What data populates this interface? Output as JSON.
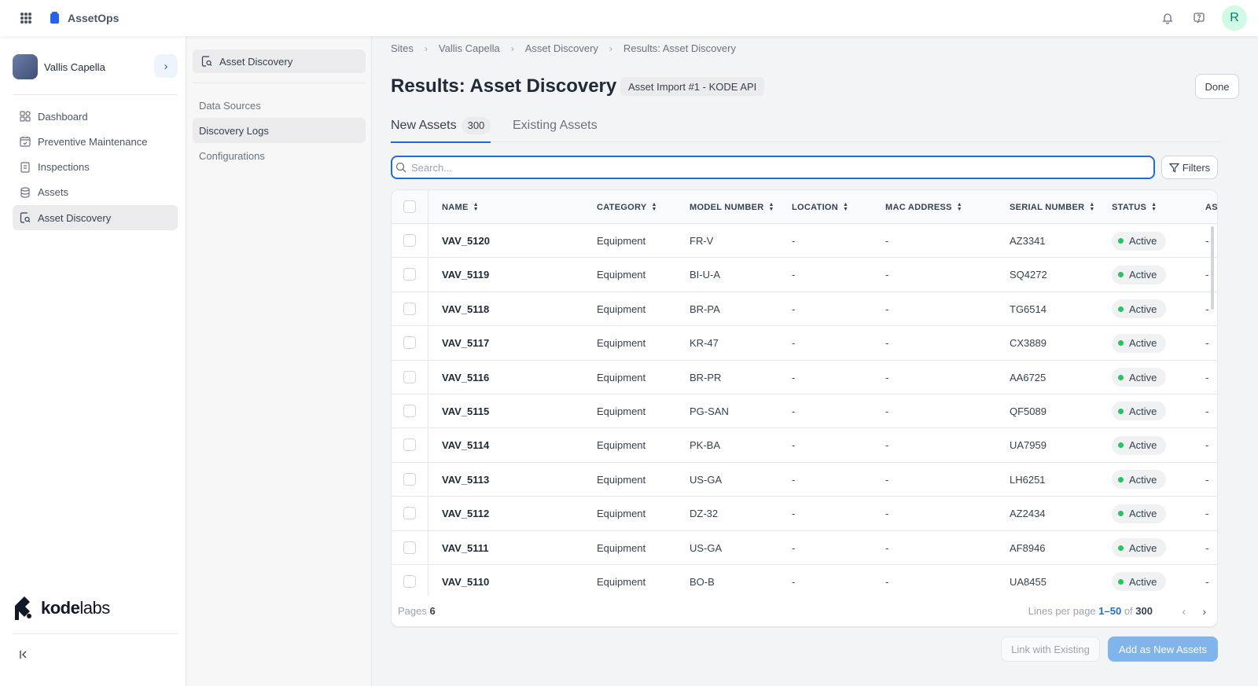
{
  "app": {
    "name": "AssetOps",
    "user_initial": "R"
  },
  "sidebar": {
    "site_name": "Vallis Capella",
    "items": [
      {
        "label": "Dashboard",
        "icon": "dashboard-icon"
      },
      {
        "label": "Preventive Maintenance",
        "icon": "calendar-icon"
      },
      {
        "label": "Inspections",
        "icon": "clipboard-icon"
      },
      {
        "label": "Assets",
        "icon": "layers-icon"
      },
      {
        "label": "Asset Discovery",
        "icon": "asset-discovery-icon",
        "active": true
      }
    ],
    "logo_text_bold": "kode",
    "logo_text_light": "labs"
  },
  "subnav": {
    "header": "Asset Discovery",
    "items": [
      {
        "label": "Data Sources"
      },
      {
        "label": "Discovery Logs",
        "active": true
      },
      {
        "label": "Configurations"
      }
    ]
  },
  "breadcrumb": [
    "Sites",
    "Vallis Capella",
    "Asset Discovery",
    "Results: Asset Discovery"
  ],
  "page": {
    "title": "Results: Asset Discovery",
    "import_badge": "Asset Import #1 - KODE API",
    "done_label": "Done"
  },
  "tabs": [
    {
      "label": "New Assets",
      "count": "300",
      "active": true
    },
    {
      "label": "Existing Assets"
    }
  ],
  "search": {
    "placeholder": "Search...",
    "filters_label": "Filters"
  },
  "table": {
    "columns": [
      "NAME",
      "CATEGORY",
      "MODEL NUMBER",
      "LOCATION",
      "MAC ADDRESS",
      "SERIAL NUMBER",
      "STATUS",
      "AS"
    ],
    "rows": [
      {
        "name": "VAV_5120",
        "category": "Equipment",
        "model": "FR-V",
        "location": "-",
        "mac": "-",
        "serial": "AZ3341",
        "status": "Active",
        "extra": "-"
      },
      {
        "name": "VAV_5119",
        "category": "Equipment",
        "model": "BI-U-A",
        "location": "-",
        "mac": "-",
        "serial": "SQ4272",
        "status": "Active",
        "extra": "-"
      },
      {
        "name": "VAV_5118",
        "category": "Equipment",
        "model": "BR-PA",
        "location": "-",
        "mac": "-",
        "serial": "TG6514",
        "status": "Active",
        "extra": "-"
      },
      {
        "name": "VAV_5117",
        "category": "Equipment",
        "model": "KR-47",
        "location": "-",
        "mac": "-",
        "serial": "CX3889",
        "status": "Active",
        "extra": "-"
      },
      {
        "name": "VAV_5116",
        "category": "Equipment",
        "model": "BR-PR",
        "location": "-",
        "mac": "-",
        "serial": "AA6725",
        "status": "Active",
        "extra": "-"
      },
      {
        "name": "VAV_5115",
        "category": "Equipment",
        "model": "PG-SAN",
        "location": "-",
        "mac": "-",
        "serial": "QF5089",
        "status": "Active",
        "extra": "-"
      },
      {
        "name": "VAV_5114",
        "category": "Equipment",
        "model": "PK-BA",
        "location": "-",
        "mac": "-",
        "serial": "UA7959",
        "status": "Active",
        "extra": "-"
      },
      {
        "name": "VAV_5113",
        "category": "Equipment",
        "model": "US-GA",
        "location": "-",
        "mac": "-",
        "serial": "LH6251",
        "status": "Active",
        "extra": "-"
      },
      {
        "name": "VAV_5112",
        "category": "Equipment",
        "model": "DZ-32",
        "location": "-",
        "mac": "-",
        "serial": "AZ2434",
        "status": "Active",
        "extra": "-"
      },
      {
        "name": "VAV_5111",
        "category": "Equipment",
        "model": "US-GA",
        "location": "-",
        "mac": "-",
        "serial": "AF8946",
        "status": "Active",
        "extra": "-"
      },
      {
        "name": "VAV_5110",
        "category": "Equipment",
        "model": "BO-B",
        "location": "-",
        "mac": "-",
        "serial": "UA8455",
        "status": "Active",
        "extra": "-"
      }
    ]
  },
  "pagination": {
    "pages_label": "Pages",
    "pages_count": "6",
    "lines_label": "Lines per page",
    "range": "1–50",
    "of_label": "of",
    "total": "300"
  },
  "actions": {
    "link_existing": "Link with Existing",
    "add_new": "Add as New Assets"
  }
}
